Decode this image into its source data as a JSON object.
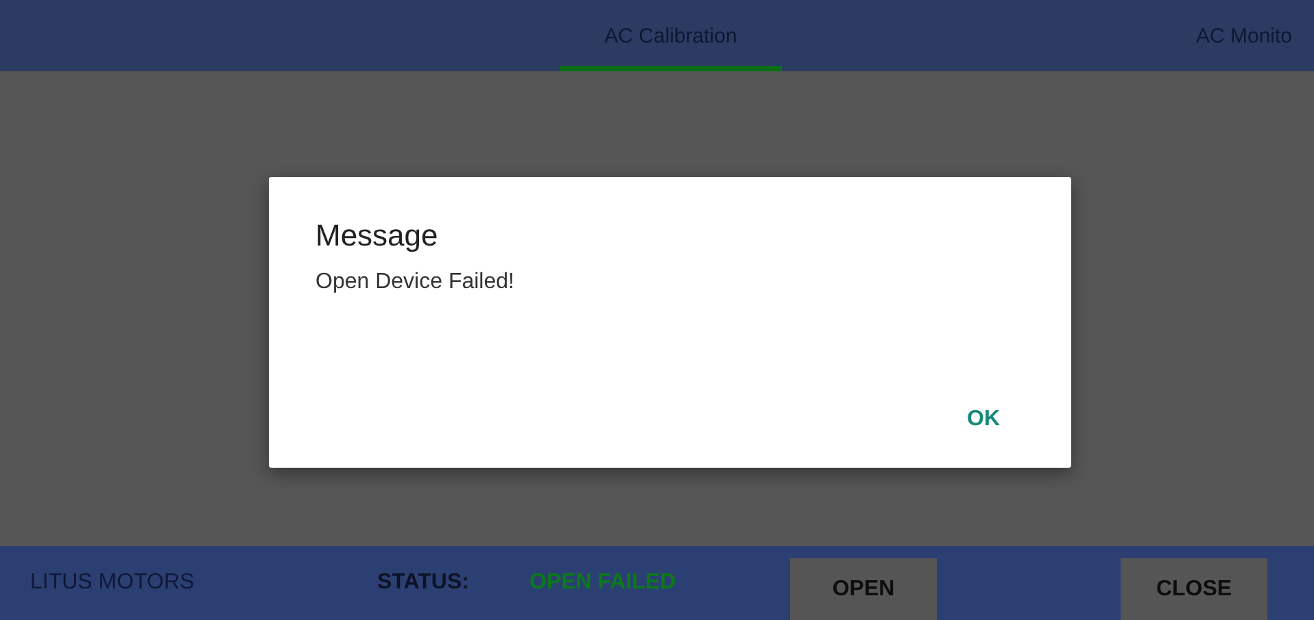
{
  "tabs": [
    {
      "label": "AC Calibration",
      "selected": true
    },
    {
      "label": "AC Monito",
      "selected": false
    }
  ],
  "dialog": {
    "title": "Message",
    "message": "Open Device Failed!",
    "buttons": [
      "OK"
    ]
  },
  "status_bar": {
    "brand": "LITUS MOTORS",
    "status_label": "STATUS:",
    "status_value": "OPEN FAILED",
    "buttons": [
      "OPEN",
      "CLOSE"
    ]
  }
}
